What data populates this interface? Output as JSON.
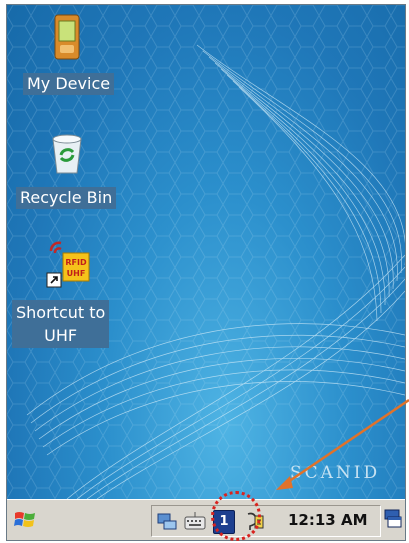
{
  "desktop": {
    "icons": [
      {
        "label": "My Device",
        "icon": "pda-device-icon"
      },
      {
        "label": "Recycle Bin",
        "icon": "recycle-bin-icon"
      },
      {
        "label_line1": "Shortcut to",
        "label_line2": "UHF",
        "icon": "rfid-uhf-shortcut-icon",
        "badge_top": "RFID",
        "badge_bottom": "UHF"
      }
    ],
    "brand": "SCANID"
  },
  "taskbar": {
    "start_icon": "windows-flag-icon",
    "tray_icons": [
      "network-icon",
      "keyboard-icon",
      "bluetooth-notification-icon",
      "battery-power-icon"
    ],
    "badge_text": "1",
    "clock": "12:13 AM",
    "desktop_icon": "show-desktop-icon"
  },
  "colors": {
    "desktop_bg": "#2b8fcc",
    "taskbar_bg": "#d9d6ce",
    "label_bg": "#3f6f98",
    "annotation_red": "#d8231f",
    "annotation_arrow": "#e0722a"
  }
}
